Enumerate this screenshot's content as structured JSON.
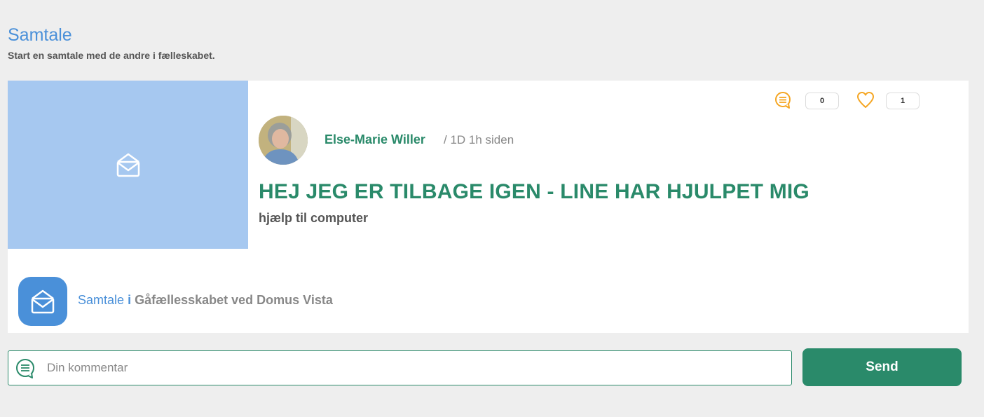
{
  "header": {
    "title": "Samtale",
    "subtitle": "Start en samtale med de andre i fælleskabet."
  },
  "post": {
    "image_icon": "envelope-open-icon",
    "stats": {
      "comment_icon": "comment-bubble-icon",
      "comment_count": "0",
      "like_icon": "heart-outline-icon",
      "like_count": "1"
    },
    "author": {
      "avatar_icon": "user-avatar",
      "name": "Else-Marie Willer",
      "timestamp": "/ 1D 1h siden"
    },
    "title": "HEJ JEG ER TILBAGE IGEN - LINE HAR HJULPET MIG",
    "body": "hjælp til computer"
  },
  "group": {
    "icon": "envelope-open-icon",
    "type": "Samtale",
    "preposition": "i",
    "name": "Gåfællesskabet ved Domus Vista"
  },
  "comment": {
    "icon": "comment-bubble-icon",
    "placeholder": "Din kommentar",
    "value": "",
    "send_label": "Send"
  },
  "colors": {
    "accent_blue": "#4a90d9",
    "accent_green": "#2a8a6a",
    "image_bg": "#a6c8f0",
    "icon_orange": "#f5a623",
    "page_bg": "#eeeeee"
  }
}
